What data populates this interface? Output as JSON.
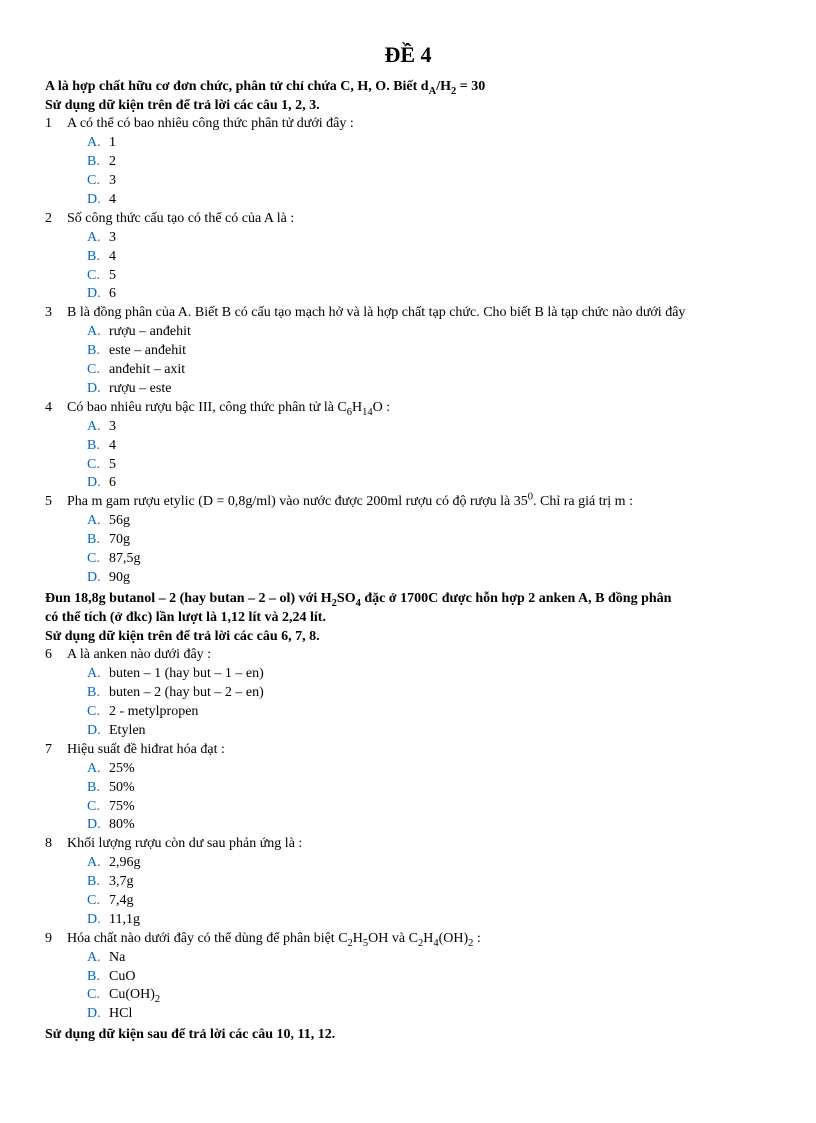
{
  "title": "ĐỀ 4",
  "intro_lines": [
    "A là hợp chất hữu cơ đơn chức, phân tử chỉ chứa C, H, O. Biết d<sub>A</sub>/H<sub>2</sub> = 30",
    "Sử dụng dữ kiện trên để trả lời các câu 1, 2, 3."
  ],
  "questions": [
    {
      "num": "1",
      "text": "A có thể có bao nhiêu công thức phân tử dưới đây :",
      "opts": [
        {
          "l": "A.",
          "t": "1"
        },
        {
          "l": "B.",
          "t": "2"
        },
        {
          "l": "C.",
          "t": "3"
        },
        {
          "l": "D.",
          "t": "4"
        }
      ]
    },
    {
      "num": "2",
      "text": "Số công thức cấu tạo có thể có của A là :",
      "opts": [
        {
          "l": "A.",
          "t": "3"
        },
        {
          "l": "B.",
          "t": "4"
        },
        {
          "l": "C.",
          "t": "5"
        },
        {
          "l": "D.",
          "t": "6"
        }
      ]
    },
    {
      "num": "3",
      "text": "B là đồng phân của A. Biết B có cấu tạo mạch hở và là hợp chất tạp chức. Cho biết B là tạp chức nào dưới đây",
      "opts": [
        {
          "l": "A.",
          "t": "rượu – anđehit"
        },
        {
          "l": "B.",
          "t": "este – anđehit"
        },
        {
          "l": "C.",
          "t": "anđehit – axit"
        },
        {
          "l": "D.",
          "t": "rượu – este"
        }
      ]
    },
    {
      "num": "4",
      "text": "Có bao nhiêu rượu bậc III, công thức phân tử là C<sub>6</sub>H<sub>14</sub>O :",
      "opts": [
        {
          "l": "A.",
          "t": "3"
        },
        {
          "l": "B.",
          "t": "4"
        },
        {
          "l": "C.",
          "t": "5"
        },
        {
          "l": "D.",
          "t": "6"
        }
      ]
    },
    {
      "num": "5",
      "text": "Pha m gam rượu etylic (D = 0,8g/ml) vào nước được 200ml rượu có độ rượu là 35<sup>0</sup>. Chỉ ra giá trị m :",
      "opts": [
        {
          "l": "A.",
          "t": "56g"
        },
        {
          "l": "B.",
          "t": "70g"
        },
        {
          "l": "C.",
          "t": "87,5g"
        },
        {
          "l": "D.",
          "t": "90g"
        }
      ]
    }
  ],
  "section2_intro": [
    "Đun 18,8g butanol – 2 (hay butan – 2 – ol) với H<sub>2</sub>SO<sub>4</sub> đặc ở 1700C được hỗn hợp 2 anken A, B đồng phân",
    "có thể tích (ở đkc) lần lượt là 1,12 lít và 2,24 lít.",
    "Sử dụng dữ kiện trên để trả lời các câu 6, 7, 8."
  ],
  "questions2": [
    {
      "num": "6",
      "text": "A là anken nào dưới đây :",
      "opts": [
        {
          "l": "A.",
          "t": "buten – 1 (hay but – 1 – en)"
        },
        {
          "l": "B.",
          "t": "buten – 2 (hay but – 2 – en)"
        },
        {
          "l": "C.",
          "t": "2 - metylpropen"
        },
        {
          "l": "D.",
          "t": "Etylen"
        }
      ]
    },
    {
      "num": "7",
      "text": "Hiệu suất đề hiđrat hóa đạt :",
      "opts": [
        {
          "l": "A.",
          "t": "25%"
        },
        {
          "l": "B.",
          "t": "50%"
        },
        {
          "l": "C.",
          "t": "75%"
        },
        {
          "l": "D.",
          "t": "80%"
        }
      ]
    },
    {
      "num": "8",
      "text": "Khối lượng rượu còn dư sau phản ứng là :",
      "opts": [
        {
          "l": "A.",
          "t": "2,96g"
        },
        {
          "l": "B.",
          "t": "3,7g"
        },
        {
          "l": "C.",
          "t": "7,4g"
        },
        {
          "l": "D.",
          "t": "11,1g"
        }
      ]
    },
    {
      "num": "9",
      "text": "Hóa chất nào dưới đây có thể dùng để phân biệt C<sub>2</sub>H<sub>5</sub>OH và C<sub>2</sub>H<sub>4</sub>(OH)<sub>2</sub> :",
      "opts": [
        {
          "l": "A.",
          "t": "Na"
        },
        {
          "l": "B.",
          "t": "CuO"
        },
        {
          "l": "C.",
          "t": "Cu(OH)<sub>2</sub>"
        },
        {
          "l": "D.",
          "t": "HCl"
        }
      ]
    }
  ],
  "footer": "Sử dụng dữ kiện sau để trả lời các câu 10, 11, 12."
}
